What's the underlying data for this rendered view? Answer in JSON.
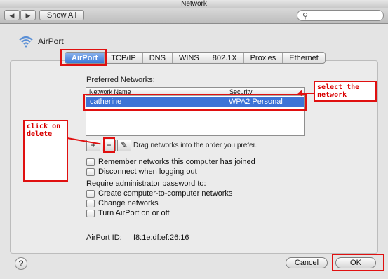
{
  "window": {
    "title": "Network"
  },
  "toolbar": {
    "back": "◀",
    "forward": "▶",
    "show_all": "Show All",
    "search_icon": "search-icon"
  },
  "airport": {
    "title": "AirPort"
  },
  "tabs": [
    "AirPort",
    "TCP/IP",
    "DNS",
    "WINS",
    "802.1X",
    "Proxies",
    "Ethernet"
  ],
  "preferred": {
    "label": "Preferred Networks:",
    "columns": [
      "Network Name",
      "Security"
    ],
    "rows": [
      {
        "name": "catherine",
        "security": "WPA2 Personal"
      }
    ],
    "add": "+",
    "remove": "−",
    "edit": "✎",
    "drag_hint": "Drag networks into the order you prefer."
  },
  "options": {
    "remember": "Remember networks this computer has joined",
    "disconnect": "Disconnect when logging out",
    "require_label": "Require administrator password to:",
    "create": "Create computer-to-computer networks",
    "change": "Change networks",
    "turn": "Turn AirPort on or off"
  },
  "airport_id": {
    "label": "AirPort ID:",
    "value": "f8:1e:df:ef:26:16"
  },
  "footer": {
    "help": "?",
    "cancel": "Cancel",
    "ok": "OK"
  },
  "annotations": {
    "select": "select the network",
    "delete": "click on delete"
  },
  "colors": {
    "annotation": "#e01010",
    "selection": "#3d73d6"
  }
}
